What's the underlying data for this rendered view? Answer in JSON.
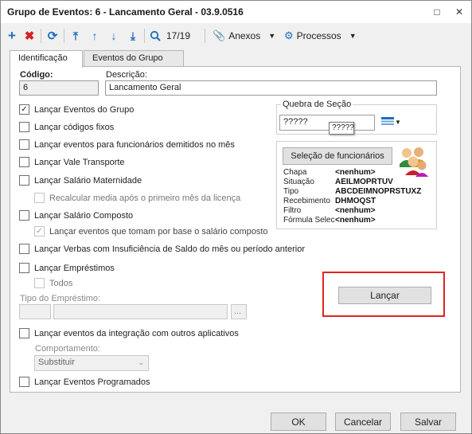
{
  "window": {
    "title": "Grupo de Eventos: 6 - Lancamento Geral - 03.9.0516"
  },
  "toolbar": {
    "nav_count": "17/19",
    "anexos": "Anexos",
    "processos": "Processos"
  },
  "tabs": [
    "Identificação",
    "Eventos do Grupo"
  ],
  "form": {
    "codigo_label": "Código:",
    "codigo_value": "6",
    "descricao_label": "Descrição:",
    "descricao_value": "Lancamento Geral"
  },
  "checkboxes": [
    {
      "label": "Lançar Eventos do Grupo",
      "checked": true
    },
    {
      "label": "Lançar códigos fixos",
      "checked": false
    },
    {
      "label": "Lançar eventos para funcionários demitidos no mês",
      "checked": false
    },
    {
      "label": "Lançar Vale Transporte",
      "checked": false
    },
    {
      "label": "Lançar Salário Maternidade",
      "checked": false
    },
    {
      "label": "Recalcular media após o primeiro mês da licença",
      "checked": false,
      "disabled": true
    },
    {
      "label": "Lançar Salário Composto",
      "checked": false
    },
    {
      "label": "Lançar eventos que tomam por base o salário composto",
      "checked": true,
      "disabled": true
    },
    {
      "label": "Lançar Verbas com Insuficiência de Saldo do mês ou período anterior",
      "checked": false
    },
    {
      "label": "Lançar Empréstimos",
      "checked": false
    },
    {
      "label": "Todos",
      "checked": false,
      "disabled": true
    },
    {
      "label": "Lançar eventos da integração com outros aplicativos",
      "checked": false
    },
    {
      "label": "Lançar Eventos Programados",
      "checked": false
    }
  ],
  "emprestimo": {
    "label": "Tipo do Empréstimo:",
    "lookup_btn": "..."
  },
  "comportamento": {
    "label": "Comportamento:",
    "value": "Substituir"
  },
  "quebra": {
    "title": "Quebra de Seção",
    "value": "?????",
    "tooltip": "?????"
  },
  "selecao": {
    "button": "Seleção de funcionários",
    "rows": [
      {
        "k": "Chapa",
        "v": "<nenhum>"
      },
      {
        "k": "Situação",
        "v": "AEILMOPRTUV"
      },
      {
        "k": "Tipo",
        "v": "ABCDEIMNOPRSTUXZ"
      },
      {
        "k": "Recebimento",
        "v": "DHMOQST"
      },
      {
        "k": "Filtro",
        "v": "<nenhum>"
      },
      {
        "k": "Fórmula Selec",
        "v": "<nenhum>"
      }
    ]
  },
  "lancar_button": "Lançar",
  "footer": {
    "ok": "OK",
    "cancelar": "Cancelar",
    "salvar": "Salvar"
  },
  "colors": {
    "accent_blue": "#1e6fc0",
    "delete_red": "#d62020",
    "highlight_red": "#e32222"
  }
}
